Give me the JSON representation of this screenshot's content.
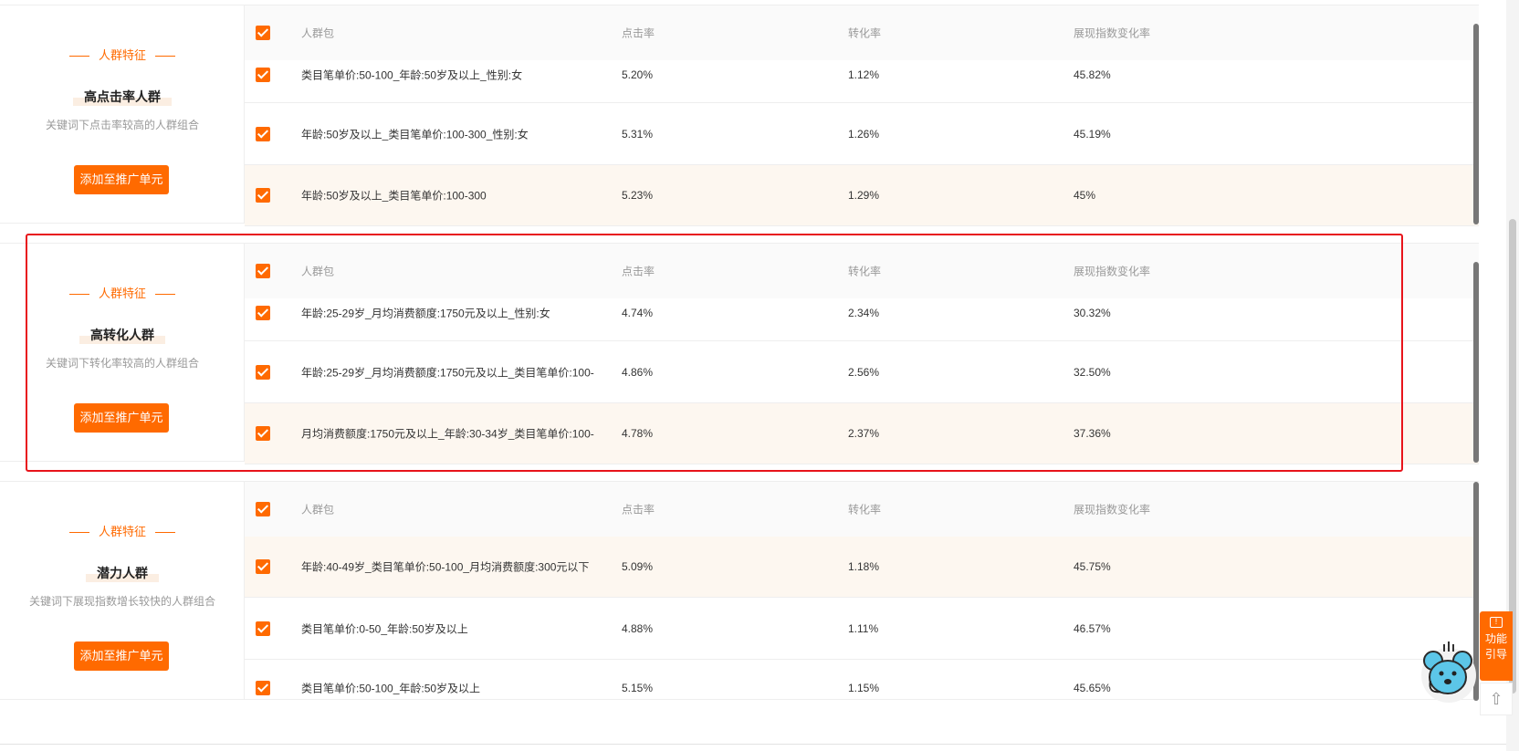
{
  "sections": [
    {
      "feature_tag": "人群特征",
      "title": "高点击率人群",
      "desc": "关键词下点击率较高的人群组合",
      "button": "添加至推广单元",
      "headers": {
        "pkg": "人群包",
        "ctr": "点击率",
        "cvr": "转化率",
        "idx": "展现指数变化率"
      },
      "rows": [
        {
          "pkg": "类目笔单价:50-100_年龄:50岁及以上_性别:女",
          "ctr": "5.20%",
          "cvr": "1.12%",
          "idx": "45.82%"
        },
        {
          "pkg": "年龄:50岁及以上_类目笔单价:100-300_性别:女",
          "ctr": "5.31%",
          "cvr": "1.26%",
          "idx": "45.19%"
        },
        {
          "pkg": "年龄:50岁及以上_类目笔单价:100-300",
          "ctr": "5.23%",
          "cvr": "1.29%",
          "idx": "45%"
        }
      ]
    },
    {
      "feature_tag": "人群特征",
      "title": "高转化人群",
      "desc": "关键词下转化率较高的人群组合",
      "button": "添加至推广单元",
      "headers": {
        "pkg": "人群包",
        "ctr": "点击率",
        "cvr": "转化率",
        "idx": "展现指数变化率"
      },
      "rows": [
        {
          "pkg": "年龄:25-29岁_月均消费额度:1750元及以上_性别:女",
          "ctr": "4.74%",
          "cvr": "2.34%",
          "idx": "30.32%"
        },
        {
          "pkg": "年龄:25-29岁_月均消费额度:1750元及以上_类目笔单价:100-",
          "ctr": "4.86%",
          "cvr": "2.56%",
          "idx": "32.50%"
        },
        {
          "pkg": "月均消费额度:1750元及以上_年龄:30-34岁_类目笔单价:100-",
          "ctr": "4.78%",
          "cvr": "2.37%",
          "idx": "37.36%"
        }
      ]
    },
    {
      "feature_tag": "人群特征",
      "title": "潜力人群",
      "desc": "关键词下展现指数增长较快的人群组合",
      "button": "添加至推广单元",
      "headers": {
        "pkg": "人群包",
        "ctr": "点击率",
        "cvr": "转化率",
        "idx": "展现指数变化率"
      },
      "rows": [
        {
          "pkg": "年龄:40-49岁_类目笔单价:50-100_月均消费额度:300元以下",
          "ctr": "5.09%",
          "cvr": "1.18%",
          "idx": "45.75%"
        },
        {
          "pkg": "类目笔单价:0-50_年龄:50岁及以上",
          "ctr": "4.88%",
          "cvr": "1.11%",
          "idx": "46.57%"
        },
        {
          "pkg": "类目笔单价:50-100_年龄:50岁及以上",
          "ctr": "5.15%",
          "cvr": "1.15%",
          "idx": "45.65%"
        }
      ]
    }
  ],
  "side": {
    "guide_label_1": "功能",
    "guide_label_2": "引导",
    "top_label": "⇧"
  },
  "colors": {
    "accent": "#ff6a00",
    "highlight_box": "#e8141b",
    "row_highlight": "#fdf7f0"
  }
}
